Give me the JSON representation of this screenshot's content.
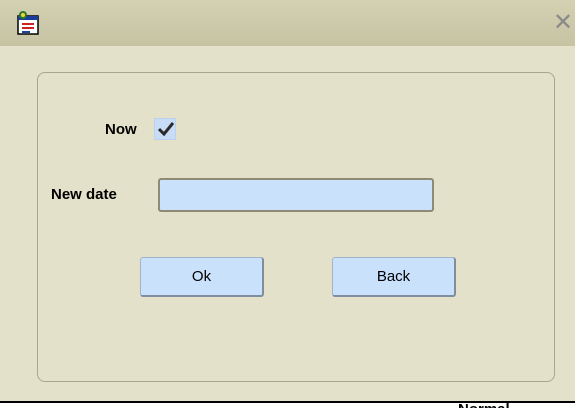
{
  "window": {
    "app_icon": "app-window-icon",
    "close_glyph": "✕"
  },
  "form": {
    "now_label": "Now",
    "now_checked": true,
    "new_date_label": "New date",
    "new_date_value": "",
    "ok_label": "Ok",
    "back_label": "Back"
  },
  "footer": {
    "partial_text": "Normal"
  },
  "colors": {
    "window_bg": "#e3e1c9",
    "field_bg": "#c9e1fb"
  }
}
